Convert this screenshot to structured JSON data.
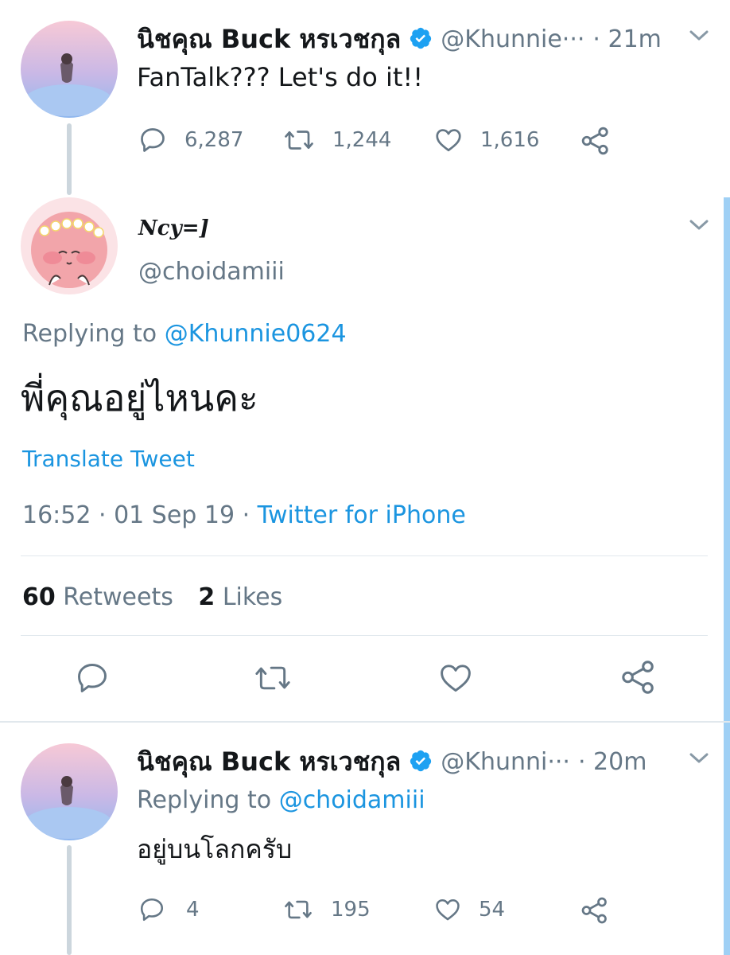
{
  "tweet1": {
    "name": "นิชคุณ Buck หรเวชกุล",
    "handle": "@Khunnie···",
    "time": "· 21m",
    "text": "FanTalk??? Let's do it!!",
    "replies": "6,287",
    "retweets": "1,244",
    "likes": "1,616"
  },
  "main_tweet": {
    "name": "Ncy=]",
    "handle": "@choidamiii",
    "replying_label": "Replying to",
    "replying_to": "@Khunnie0624",
    "text": "พี่คุณอยู่ไหนคะ",
    "translate": "Translate Tweet",
    "timestamp": "16:52 · 01 Sep 19 ·",
    "source": "Twitter for iPhone",
    "retweet_count": "60",
    "retweet_label": "Retweets",
    "like_count": "2",
    "like_label": "Likes"
  },
  "tweet3": {
    "name": "นิชคุณ Buck หรเวชกุล",
    "handle": "@Khunni···",
    "time": "· 20m",
    "replying_label": "Replying to",
    "replying_to": "@choidamiii",
    "text": "อยู่บนโลกครับ",
    "replies": "4",
    "retweets": "195",
    "likes": "54"
  },
  "colors": {
    "link": "#1b95e0",
    "secondary_text": "#657786",
    "verified": "#1da1f2"
  }
}
